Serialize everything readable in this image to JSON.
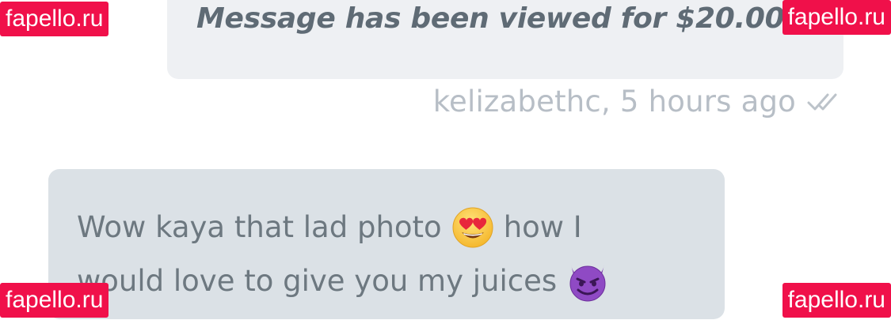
{
  "sent_message": {
    "text": "Message has been viewed for $20.00"
  },
  "meta": {
    "sender_time": "kelizabethc, 5 hours ago",
    "status_icon": "double-check-icon"
  },
  "received_message": {
    "line1_part1": "Wow kaya that lad photo",
    "emoji1": "heart-eyes-emoji",
    "line1_part2": "how I",
    "line2": "would love to give you my juices",
    "emoji2": "smiling-devil-emoji"
  },
  "watermark": {
    "text": "fapello.ru",
    "color": "#f0104a"
  },
  "colors": {
    "sent_bubble": "#eef0f3",
    "received_bubble": "#dbe1e6",
    "sent_text": "#5f6b75",
    "received_text": "#6d7880",
    "meta_text": "#b7bec6"
  }
}
